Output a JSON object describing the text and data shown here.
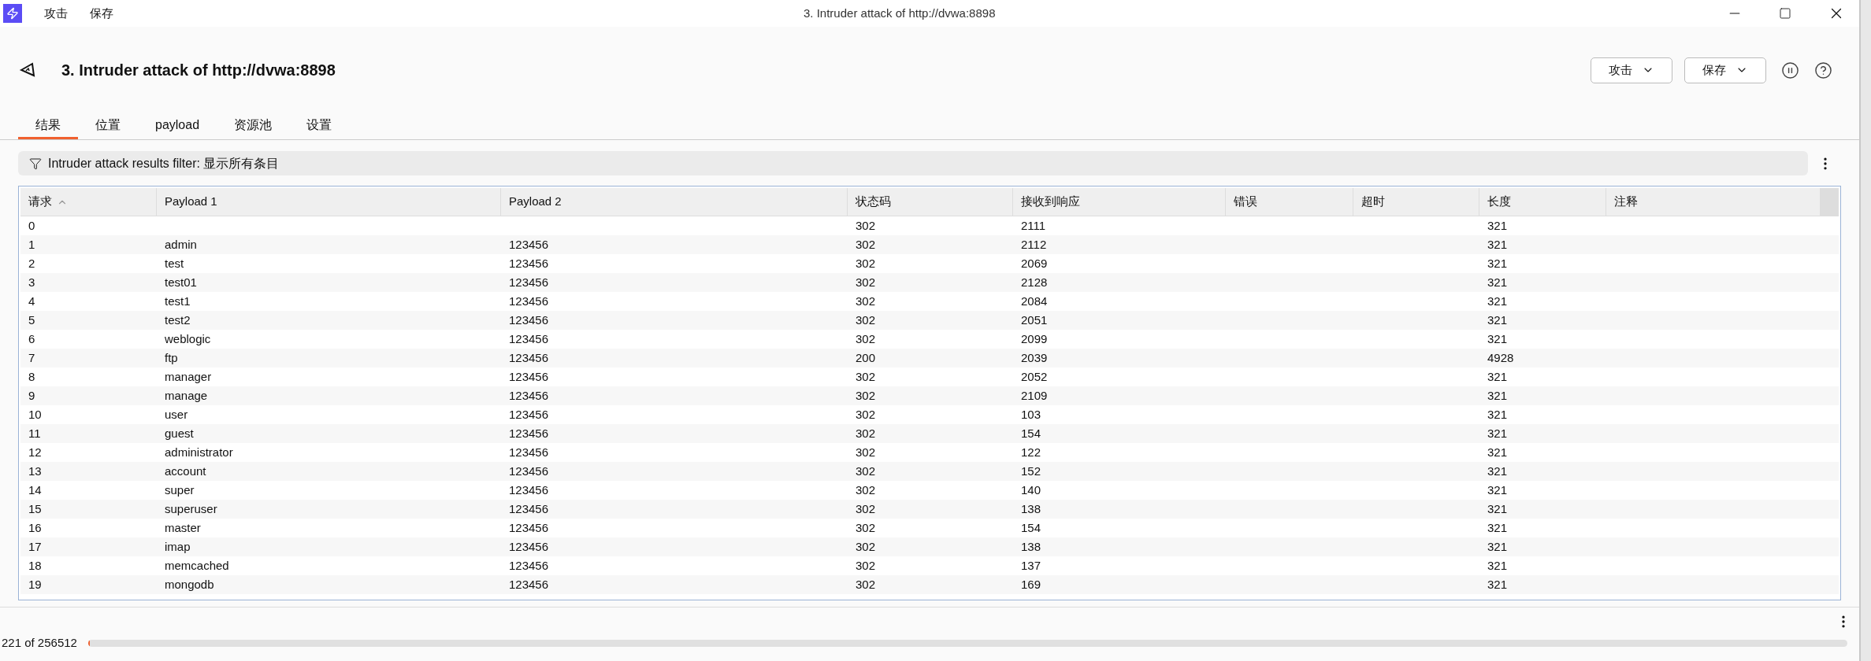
{
  "window": {
    "title": "3. Intruder attack of http://dvwa:8898"
  },
  "menu": [
    "攻击",
    "保存"
  ],
  "header": {
    "title": "3. Intruder attack of http://dvwa:8898",
    "buttons": [
      "攻击",
      "保存"
    ]
  },
  "tabs": [
    {
      "label": "结果",
      "selected": true
    },
    {
      "label": "位置",
      "selected": false
    },
    {
      "label": "payload",
      "selected": false
    },
    {
      "label": "资源池",
      "selected": false
    },
    {
      "label": "设置",
      "selected": false
    }
  ],
  "filter": {
    "text": "Intruder attack results filter: 显示所有条目"
  },
  "table": {
    "columns": [
      {
        "label": "请求",
        "sorted": true
      },
      {
        "label": "Payload 1",
        "sorted": false
      },
      {
        "label": "Payload 2",
        "sorted": false
      },
      {
        "label": "状态码",
        "sorted": false
      },
      {
        "label": "接收到响应",
        "sorted": false
      },
      {
        "label": "错误",
        "sorted": false
      },
      {
        "label": "超时",
        "sorted": false
      },
      {
        "label": "长度",
        "sorted": false
      },
      {
        "label": "注释",
        "sorted": false
      }
    ],
    "rows": [
      {
        "request": "0",
        "status": "302",
        "received": "2111",
        "length": "321"
      },
      {
        "request": "1",
        "payload1": "admin",
        "payload2": "123456",
        "status": "302",
        "received": "2112",
        "length": "321"
      },
      {
        "request": "2",
        "payload1": "test",
        "payload2": "123456",
        "status": "302",
        "received": "2069",
        "length": "321"
      },
      {
        "request": "3",
        "payload1": "test01",
        "payload2": "123456",
        "status": "302",
        "received": "2128",
        "length": "321"
      },
      {
        "request": "4",
        "payload1": "test1",
        "payload2": "123456",
        "status": "302",
        "received": "2084",
        "length": "321"
      },
      {
        "request": "5",
        "payload1": "test2",
        "payload2": "123456",
        "status": "302",
        "received": "2051",
        "length": "321"
      },
      {
        "request": "6",
        "payload1": "weblogic",
        "payload2": "123456",
        "status": "302",
        "received": "2099",
        "length": "321"
      },
      {
        "request": "7",
        "payload1": "ftp",
        "payload2": "123456",
        "status": "200",
        "received": "2039",
        "length": "4928"
      },
      {
        "request": "8",
        "payload1": "manager",
        "payload2": "123456",
        "status": "302",
        "received": "2052",
        "length": "321"
      },
      {
        "request": "9",
        "payload1": "manage",
        "payload2": "123456",
        "status": "302",
        "received": "2109",
        "length": "321"
      },
      {
        "request": "10",
        "payload1": "user",
        "payload2": "123456",
        "status": "302",
        "received": "103",
        "length": "321"
      },
      {
        "request": "11",
        "payload1": "guest",
        "payload2": "123456",
        "status": "302",
        "received": "154",
        "length": "321"
      },
      {
        "request": "12",
        "payload1": "administrator",
        "payload2": "123456",
        "status": "302",
        "received": "122",
        "length": "321"
      },
      {
        "request": "13",
        "payload1": "account",
        "payload2": "123456",
        "status": "302",
        "received": "152",
        "length": "321"
      },
      {
        "request": "14",
        "payload1": "super",
        "payload2": "123456",
        "status": "302",
        "received": "140",
        "length": "321"
      },
      {
        "request": "15",
        "payload1": "superuser",
        "payload2": "123456",
        "status": "302",
        "received": "138",
        "length": "321"
      },
      {
        "request": "16",
        "payload1": "master",
        "payload2": "123456",
        "status": "302",
        "received": "154",
        "length": "321"
      },
      {
        "request": "17",
        "payload1": "imap",
        "payload2": "123456",
        "status": "302",
        "received": "138",
        "length": "321"
      },
      {
        "request": "18",
        "payload1": "memcached",
        "payload2": "123456",
        "status": "302",
        "received": "137",
        "length": "321"
      },
      {
        "request": "19",
        "payload1": "mongodb",
        "payload2": "123456",
        "status": "302",
        "received": "169",
        "length": "321"
      }
    ]
  },
  "status_bar": {
    "progress": "221 of 256512",
    "level": 0.001
  }
}
